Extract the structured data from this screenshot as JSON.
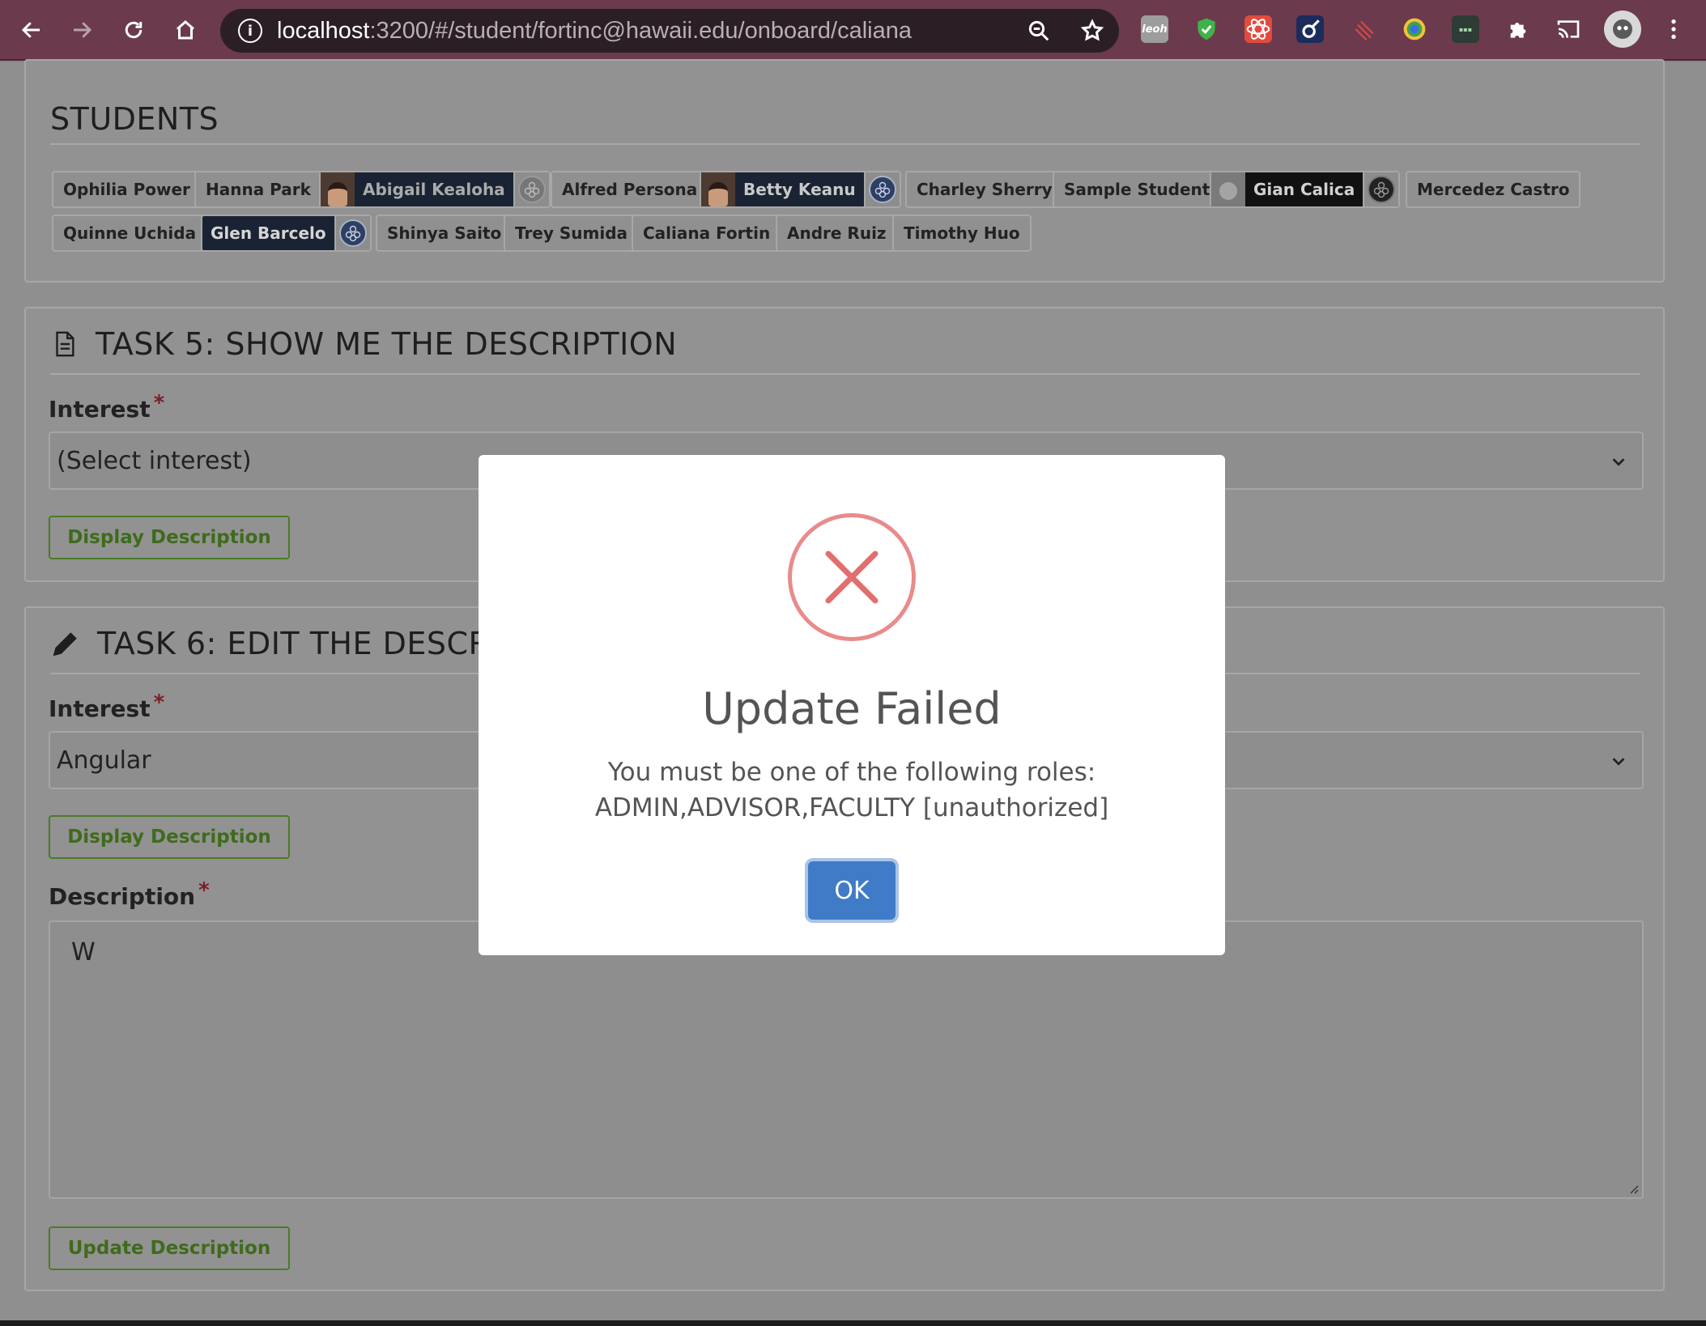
{
  "browser": {
    "url_host": "localhost",
    "url_rest": ":3200/#/student/fortinc@hawaii.edu/onboard/caliana",
    "extensions": [
      "leoh-extension-icon",
      "shield-check-extension-icon",
      "react-devtools-extension-icon",
      "hyperlink-extension-icon",
      "stripes-extension-icon",
      "color-picker-extension-icon",
      "screen-extension-icon",
      "puzzle-extensions-icon",
      "cast-icon",
      "profile-avatar",
      "menu-dots-icon"
    ],
    "leoh_label": "leoh"
  },
  "students_card": {
    "title": "STUDENTS",
    "row1": [
      "Ophilia Power",
      "Hanna Park",
      "Abigail Kealoha",
      "Alfred Persona",
      "Betty Keanu",
      "Charley Sherry",
      "Sample Student",
      "Gian Calica",
      "Mercedez Castro"
    ],
    "row2": [
      "Quinne Uchida",
      "Glen Barcelo",
      "Shinya Saito",
      "Trey Sumida",
      "Caliana Fortin",
      "Andre Ruiz",
      "Timothy Huo"
    ]
  },
  "task5": {
    "title": "TASK 5: SHOW ME THE DESCRIPTION",
    "interest_label": "Interest",
    "required_mark": "*",
    "interest_value": "(Select interest)",
    "display_button": "Display Description"
  },
  "task6": {
    "title": "TASK 6: EDIT THE DESCRIPTION",
    "interest_label": "Interest",
    "required_mark": "*",
    "interest_value": "Angular",
    "display_button": "Display Description",
    "description_label": "Description",
    "description_value": "W",
    "update_button": "Update Description"
  },
  "modal": {
    "title": "Update Failed",
    "line1": "You must be one of the following roles:",
    "line2": "ADMIN,ADVISOR,FACULTY [unauthorized]",
    "ok_label": "OK"
  },
  "colors": {
    "chrome_bg": "#6b3a4d",
    "error_red": "#e98b8b",
    "ok_blue": "#3f7bc7",
    "green_outline": "#4c7a26"
  }
}
